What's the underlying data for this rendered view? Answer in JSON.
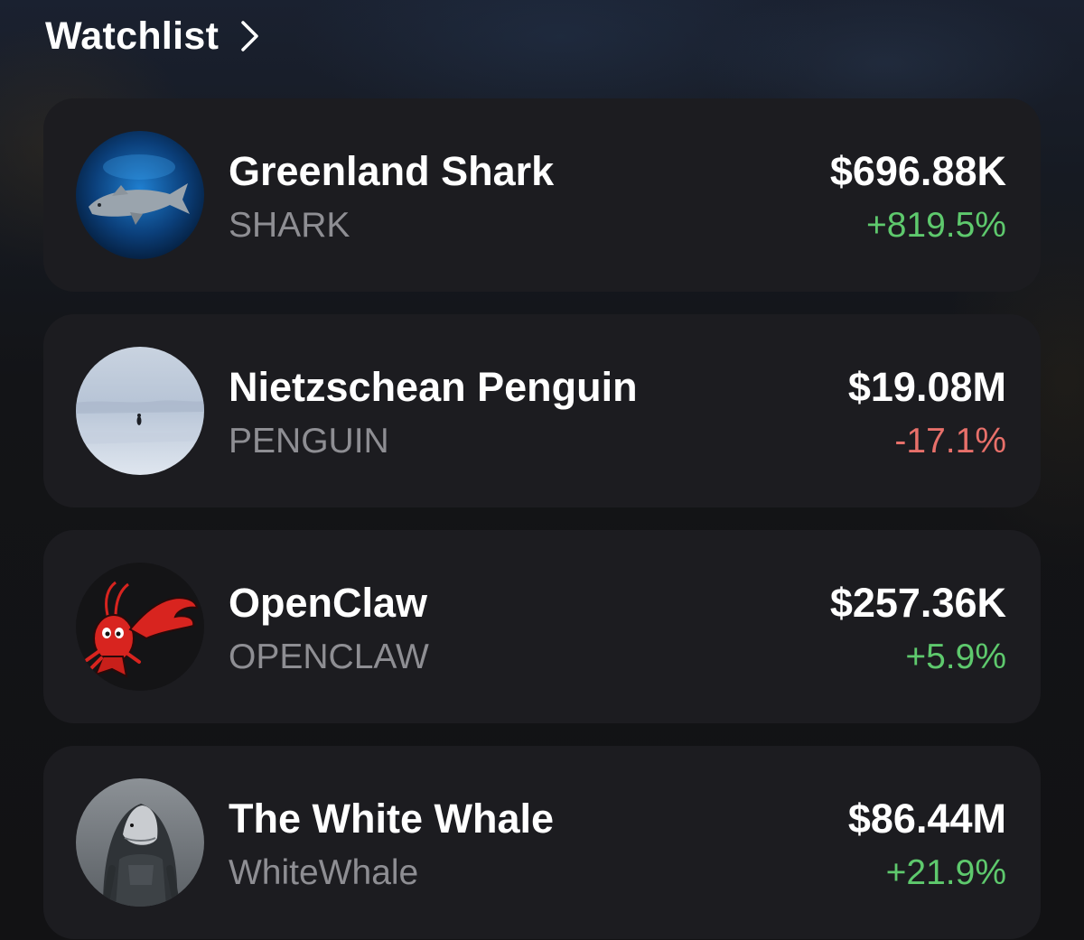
{
  "header": {
    "title": "Watchlist",
    "chevron_icon": "chevron-right-icon"
  },
  "colors": {
    "positive": "#5ec96d",
    "negative": "#e8706a",
    "card_background": "#1c1c20",
    "ticker_text": "#8e8e93"
  },
  "items": [
    {
      "name": "Greenland Shark",
      "ticker": "SHARK",
      "price": "$696.88K",
      "change": "+819.5%",
      "direction": "up",
      "avatar_icon": "shark-avatar"
    },
    {
      "name": "Nietzschean Penguin",
      "ticker": "PENGUIN",
      "price": "$19.08M",
      "change": "-17.1%",
      "direction": "down",
      "avatar_icon": "penguin-avatar"
    },
    {
      "name": "OpenClaw",
      "ticker": "OPENCLAW",
      "price": "$257.36K",
      "change": "+5.9%",
      "direction": "up",
      "avatar_icon": "lobster-avatar"
    },
    {
      "name": "The White Whale",
      "ticker": "WhiteWhale",
      "price": "$86.44M",
      "change": "+21.9%",
      "direction": "up",
      "avatar_icon": "whale-warrior-avatar"
    }
  ]
}
